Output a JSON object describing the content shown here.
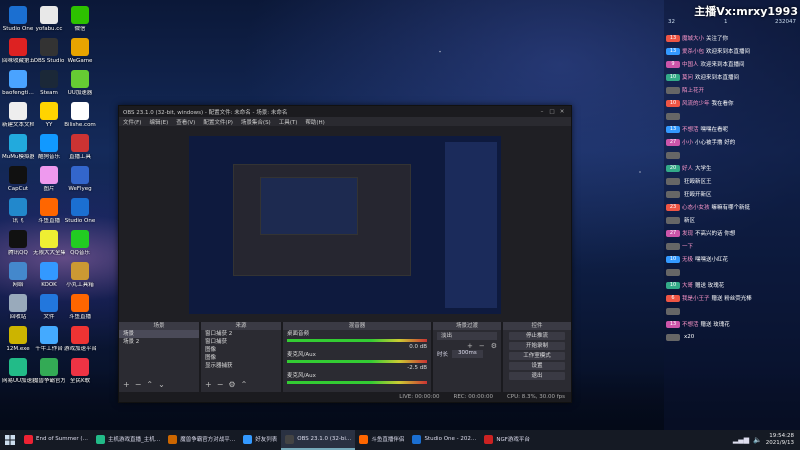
{
  "desktop_icons": [
    {
      "label": "Studio One",
      "color": "#1b6fd1"
    },
    {
      "label": "yofabu.cc",
      "color": "#e8e8e8"
    },
    {
      "label": "微信",
      "color": "#2dc100"
    },
    {
      "label": "回味收藏第五卷",
      "color": "#d22"
    },
    {
      "label": "OBS Studio",
      "color": "#333"
    },
    {
      "label": "WeGame",
      "color": "#e8a400"
    },
    {
      "label": "baofengti…",
      "color": "#4aa3ff"
    },
    {
      "label": "Steam",
      "color": "#1b2838"
    },
    {
      "label": "UU加速器",
      "color": "#6c3"
    },
    {
      "label": "新建文本文档.txt",
      "color": "#eee"
    },
    {
      "label": "YY",
      "color": "#ffd400"
    },
    {
      "label": "Bilishe.com",
      "color": "#fff"
    },
    {
      "label": "MuMu模拟器",
      "color": "#2ad"
    },
    {
      "label": "酷狗音乐",
      "color": "#19f"
    },
    {
      "label": "直播工具",
      "color": "#c33"
    },
    {
      "label": "CapCut",
      "color": "#111"
    },
    {
      "label": "图片",
      "color": "#e9e"
    },
    {
      "label": "WeFlyeg",
      "color": "#36c"
    },
    {
      "label": "讯飞",
      "color": "#28c"
    },
    {
      "label": "斗鱼直播",
      "color": "#f60"
    },
    {
      "label": "Studio One",
      "color": "#1b6fd1"
    },
    {
      "label": "腾讯QQ",
      "color": "#111"
    },
    {
      "label": "无限大大全集",
      "color": "#ee3"
    },
    {
      "label": "QQ音乐",
      "color": "#2c2"
    },
    {
      "label": "网络",
      "color": "#48c"
    },
    {
      "label": "KOOK",
      "color": "#39f"
    },
    {
      "label": "小丸工具箱",
      "color": "#c93"
    },
    {
      "label": "回收站",
      "color": "#9ab"
    },
    {
      "label": "文件",
      "color": "#27d"
    },
    {
      "label": "斗鱼直播",
      "color": "#f60"
    },
    {
      "label": "12M.exe",
      "color": "#ccb400"
    },
    {
      "label": "千牛工作台",
      "color": "#4af"
    },
    {
      "label": "游戏加速平台",
      "color": "#e33"
    },
    {
      "label": "网易UU加速器",
      "color": "#2b8"
    },
    {
      "label": "魔兽争霸官方对战平台",
      "color": "#3a5"
    },
    {
      "label": "全民K歌",
      "color": "#e34"
    }
  ],
  "obs": {
    "title": "OBS 23.1.0 (32-bit, windows) - 配置文件: 未命名 - 场景: 未命名",
    "menu": [
      "文件(F)",
      "编辑(E)",
      "查看(V)",
      "配置文件(P)",
      "场景集合(S)",
      "工具(T)",
      "帮助(H)"
    ],
    "docks": {
      "scenes": {
        "title": "场景",
        "items": [
          "场景",
          "场景 2"
        ]
      },
      "sources": {
        "title": "来源",
        "items": [
          "窗口捕获 2",
          "窗口捕获",
          "图像",
          "图像",
          "显示器捕获"
        ]
      },
      "mixer": {
        "title": "混音器",
        "channels": [
          {
            "name": "桌面音频",
            "db": "0.0 dB"
          },
          {
            "name": "麦克风/Aux",
            "db": "-2.5 dB"
          },
          {
            "name": "麦克风/Aux",
            "db": "0.0 dB"
          }
        ]
      },
      "transitions": {
        "title": "场景过渡",
        "type": "淡出",
        "duration_label": "时长",
        "duration": "300ms"
      },
      "controls": {
        "title": "控件",
        "buttons": [
          "停止推流",
          "开始录制",
          "工作室模式",
          "设置",
          "退出"
        ]
      }
    },
    "status": [
      "LIVE: 00:00:00",
      "REC: 00:00:00",
      "CPU: 8.3%, 30.00 fps"
    ]
  },
  "chat": {
    "title": "主播Vx:mrxy1993",
    "stats": [
      "32",
      "1",
      "232047"
    ],
    "messages": [
      {
        "badge": "13",
        "badge_color": "#e54",
        "name": "魔城大小",
        "text": "关注了你"
      },
      {
        "badge": "13",
        "badge_color": "#39f",
        "name": "爱杀小包",
        "text": "欢迎来到本直播间"
      },
      {
        "badge": "9",
        "badge_color": "#c5a",
        "name": "中国人",
        "text": "欢迎来到本直播间"
      },
      {
        "badge": "10",
        "badge_color": "#3a8",
        "name": "莫问",
        "text": "欢迎来到本直播间"
      },
      {
        "badge": "",
        "badge_color": "#666",
        "name": "陌上花开",
        "text": ""
      },
      {
        "badge": "10",
        "badge_color": "#e54",
        "name": "风流的少年",
        "text": "我在看你"
      },
      {
        "badge": "",
        "badge_color": "#666",
        "name": "",
        "text": ""
      },
      {
        "badge": "13",
        "badge_color": "#39f",
        "name": "不想活",
        "text": "嘿嘿在看呢"
      },
      {
        "badge": "27",
        "badge_color": "#c5a",
        "name": "小小",
        "text": "小心被手撸 好的"
      },
      {
        "badge": "",
        "badge_color": "#666",
        "name": "",
        "text": ""
      },
      {
        "badge": "20",
        "badge_color": "#3a8",
        "name": "好人",
        "text": "大学生"
      },
      {
        "badge": "",
        "badge_color": "#666",
        "name": "",
        "text": "狂殴新区王"
      },
      {
        "badge": "",
        "badge_color": "#666",
        "name": "",
        "text": "狂殴开新区"
      },
      {
        "badge": "23",
        "badge_color": "#e54",
        "name": "心态小女孩",
        "text": "嘛嘛有哪个新挺"
      },
      {
        "badge": "",
        "badge_color": "#666",
        "name": "",
        "text": "新区"
      },
      {
        "badge": "27",
        "badge_color": "#c5a",
        "name": "发现",
        "text": "不高兴的话 你想"
      },
      {
        "badge": "",
        "badge_color": "#666",
        "name": "一下",
        "text": ""
      },
      {
        "badge": "10",
        "badge_color": "#39f",
        "name": "无极",
        "text": "嘿嘿送小红花"
      },
      {
        "badge": "",
        "badge_color": "#666",
        "name": "",
        "text": ""
      },
      {
        "badge": "10",
        "badge_color": "#3a8",
        "name": "大哥",
        "text": "赠送 玫瑰花"
      },
      {
        "badge": "6",
        "badge_color": "#e54",
        "name": "我是小王子",
        "text": "赠送 粉丝荧光棒"
      },
      {
        "badge": "",
        "badge_color": "#666",
        "name": "",
        "text": ""
      },
      {
        "badge": "13",
        "badge_color": "#c5a",
        "name": "不想活",
        "text": "赠送 玫瑰花"
      },
      {
        "badge": "",
        "badge_color": "#666",
        "name": "",
        "text": "x20"
      }
    ]
  },
  "taskbar": {
    "items": [
      {
        "label": "End of Summer (…",
        "color": "#e23"
      },
      {
        "label": "主机游戏直播_主机…",
        "color": "#2b8"
      },
      {
        "label": "魔兽争霸官方对战平…",
        "color": "#c60"
      },
      {
        "label": "好友列表",
        "color": "#39f"
      },
      {
        "label": "OBS 23.1.0 (32-bi…",
        "color": "#444",
        "active": true
      },
      {
        "label": "斗鱼直播伴侣",
        "color": "#f60"
      },
      {
        "label": "Studio One - 202…",
        "color": "#1b6fd1"
      },
      {
        "label": "NGF游戏平台",
        "color": "#c22"
      }
    ],
    "time": "19:54:28",
    "date": "2021/9/13"
  }
}
